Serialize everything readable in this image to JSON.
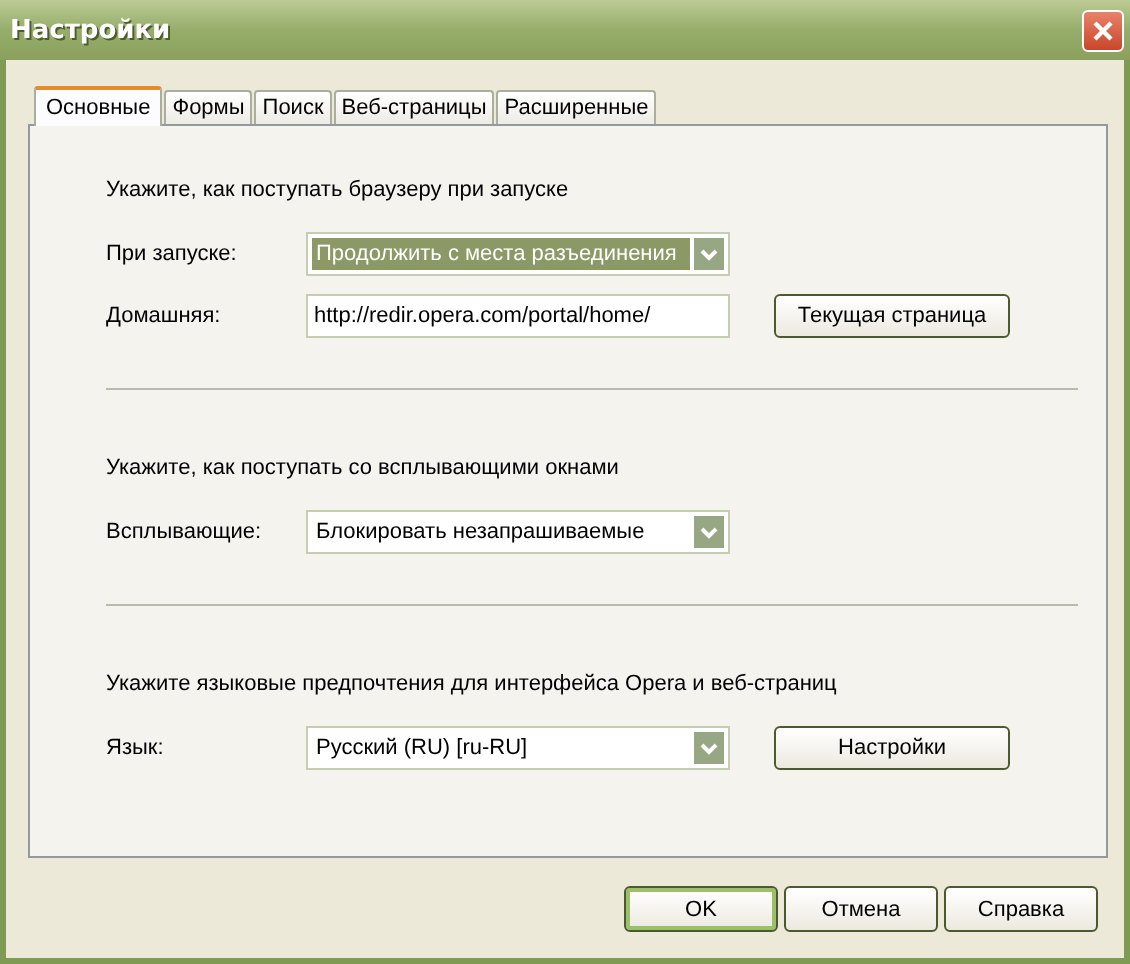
{
  "window": {
    "title": "Настройки"
  },
  "tabs": [
    {
      "label": "Основные",
      "selected": true
    },
    {
      "label": "Формы",
      "selected": false
    },
    {
      "label": "Поиск",
      "selected": false
    },
    {
      "label": "Веб-страницы",
      "selected": false
    },
    {
      "label": "Расширенные",
      "selected": false
    }
  ],
  "sections": [
    {
      "heading": "Укажите, как поступать браузеру при запуске",
      "rows": [
        {
          "label": "При запуске:",
          "kind": "dropdown",
          "value": "Продолжить с места разъединения",
          "focused": true
        },
        {
          "label": "Домашняя:",
          "kind": "field",
          "value": "http://redir.opera.com/portal/home/",
          "button": "Текущая страница"
        }
      ]
    },
    {
      "heading": "Укажите, как поступать со всплывающими окнами",
      "rows": [
        {
          "label": "Всплывающие:",
          "kind": "dropdown",
          "value": "Блокировать незапрашиваемые",
          "focused": false
        }
      ]
    },
    {
      "heading": "Укажите языковые предпочтения для интерфейса Opera и веб-страниц",
      "rows": [
        {
          "label": "Язык:",
          "kind": "dropdown",
          "value": "Русский (RU) [ru-RU]",
          "focused": false,
          "button": "Настройки"
        }
      ]
    }
  ],
  "buttons": [
    {
      "label": "OK",
      "default": true
    },
    {
      "label": "Отмена",
      "default": false
    },
    {
      "label": "Справка",
      "default": false
    }
  ]
}
